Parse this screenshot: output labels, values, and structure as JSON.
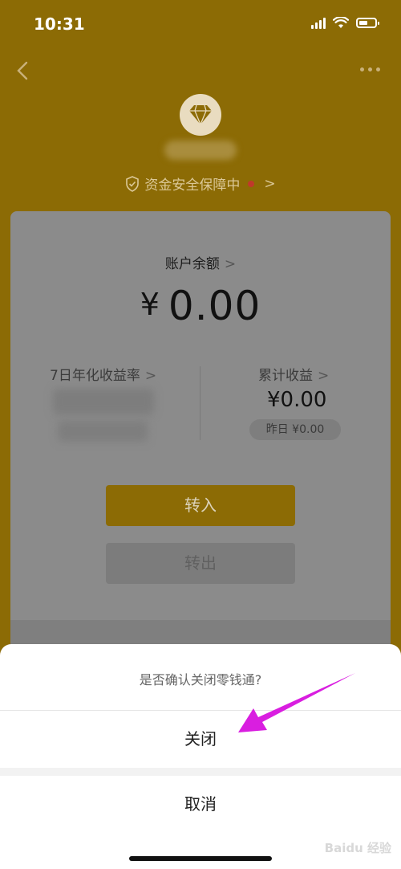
{
  "status_bar": {
    "time": "10:31"
  },
  "page": {
    "security_text": "资金安全保障中",
    "balance_label": "账户余额",
    "balance_currency": "¥",
    "balance_value": "0.00",
    "rate_label": "7日年化收益率",
    "earnings_label": "累计收益",
    "earnings_value": "¥0.00",
    "yesterday_text": "昨日 ¥0.00",
    "transfer_in_label": "转入",
    "transfer_out_label": "转出",
    "chevron": ">"
  },
  "action_sheet": {
    "title": "是否确认关闭零钱通?",
    "close_label": "关闭",
    "cancel_label": "取消"
  },
  "watermark": "Baidu 经验",
  "colors": {
    "header_bg": "#8c6b05",
    "annotation_arrow": "#d91ee0",
    "primary_button": "#8c6b05"
  }
}
